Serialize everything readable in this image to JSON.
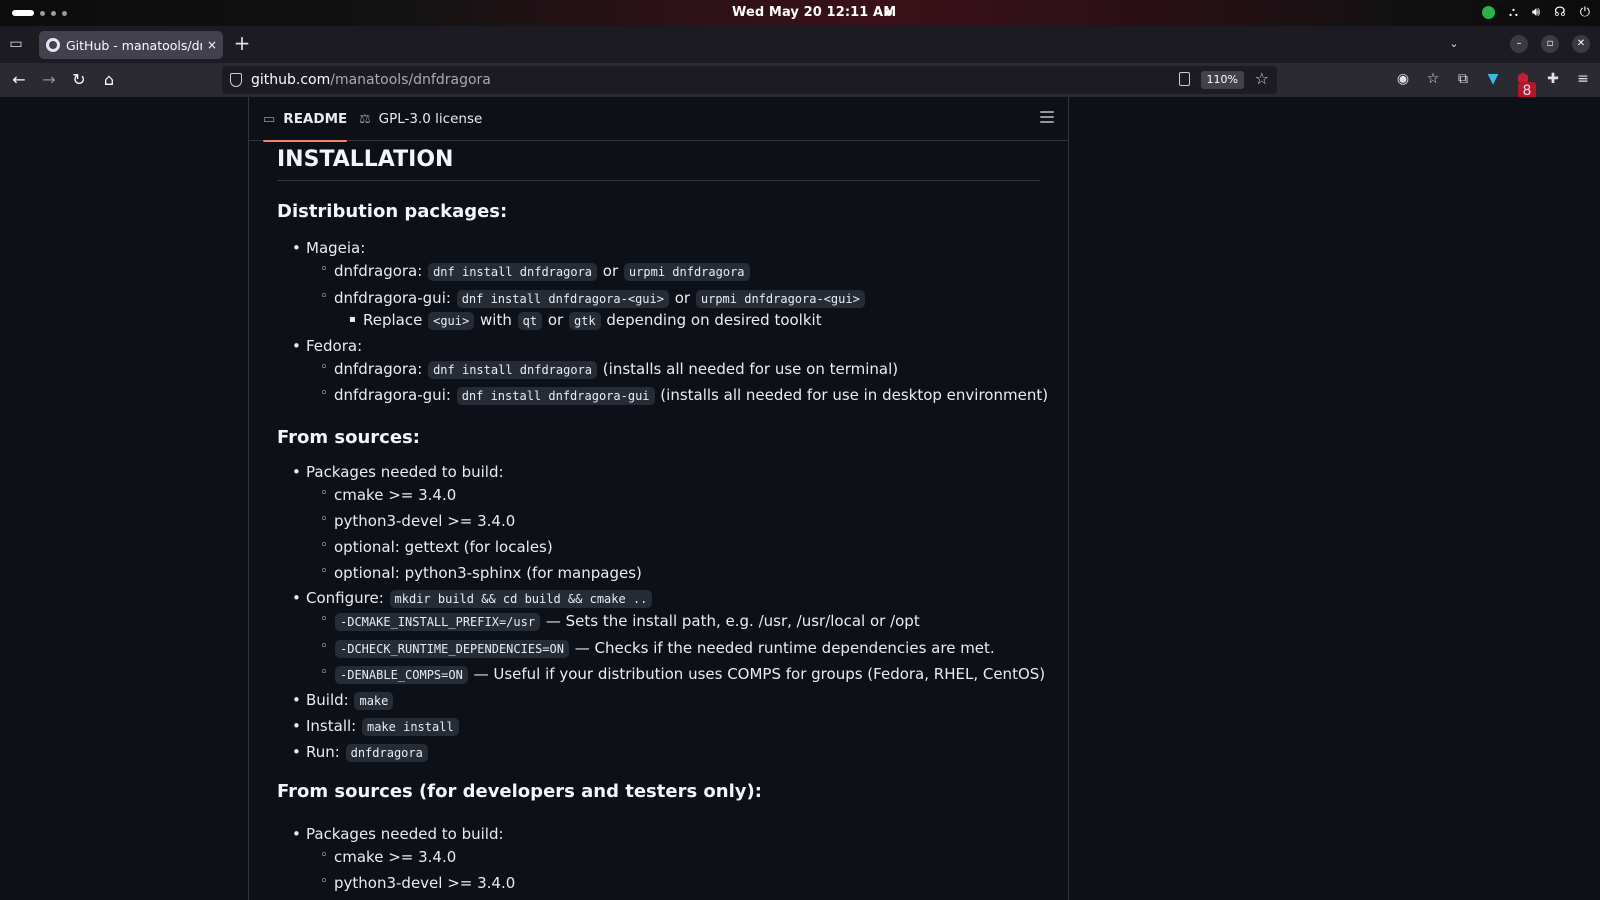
{
  "system": {
    "clock": "Wed May 20  12:11 AM",
    "tray_icons": [
      "chat-icon",
      "network-icon",
      "volume-icon",
      "headphones-icon",
      "power-icon"
    ]
  },
  "browser": {
    "tab": {
      "title": "GitHub - manatools/dnfdragora",
      "close": "×"
    },
    "newtab": "+",
    "url": {
      "host": "github.com",
      "path": "/manatools/dnfdragora"
    },
    "zoom": "110%",
    "extension_badge": "8",
    "window_controls": {
      "minimize": "–",
      "maximize": "▫",
      "close": "✕"
    }
  },
  "readme": {
    "tabs": [
      {
        "label": "README",
        "icon": "book-icon"
      },
      {
        "label": "GPL-3.0 license",
        "icon": "scale-icon"
      }
    ],
    "h1": "INSTALLATION",
    "sec1": {
      "title": "Distribution packages:",
      "mageia": "Mageia:",
      "m_a": {
        "pre": "dnfdragora: ",
        "c1": "dnf install dnfdragora",
        "mid": " or ",
        "c2": "urpmi dnfdragora"
      },
      "m_b": {
        "pre": "dnfdragora-gui: ",
        "c1": "dnf install dnfdragora-<gui>",
        "mid": " or ",
        "c2": "urpmi dnfdragora-<gui>"
      },
      "m_c": {
        "pre": "Replace ",
        "c1": "<gui>",
        "m1": " with ",
        "c2": "qt",
        "m2": " or ",
        "c3": "gtk",
        "post": " depending on desired toolkit"
      },
      "fedora": "Fedora:",
      "f_a": {
        "pre": "dnfdragora: ",
        "c1": "dnf install dnfdragora",
        "post": " (installs all needed for use on terminal)"
      },
      "f_b": {
        "pre": "dnfdragora-gui: ",
        "c1": "dnf install dnfdragora-gui",
        "post": " (installs all needed for use in desktop environment)"
      }
    },
    "sec2": {
      "title": "From sources:",
      "packages": "Packages needed to build:",
      "p1": "cmake >= 3.4.0",
      "p2": "python3-devel >= 3.4.0",
      "p3": "optional: gettext (for locales)",
      "p4": "optional: python3-sphinx (for manpages)",
      "configure": {
        "pre": "Configure: ",
        "c1": "mkdir build && cd build && cmake .."
      },
      "opt1": {
        "c1": "-DCMAKE_INSTALL_PREFIX=/usr",
        "post": " — Sets the install path, e.g. /usr, /usr/local or /opt"
      },
      "opt2": {
        "c1": "-DCHECK_RUNTIME_DEPENDENCIES=ON",
        "post": " — Checks if the needed runtime dependencies are met."
      },
      "opt3": {
        "c1": "-DENABLE_COMPS=ON",
        "post": " — Useful if your distribution uses COMPS for groups (Fedora, RHEL, CentOS)"
      },
      "build": {
        "pre": "Build: ",
        "c1": "make"
      },
      "install": {
        "pre": "Install: ",
        "c1": "make install"
      },
      "run": {
        "pre": "Run: ",
        "c1": "dnfdragora"
      }
    },
    "sec3": {
      "title": "From sources (for developers and testers only):",
      "packages": "Packages needed to build:",
      "p1": "cmake >= 3.4.0",
      "p2": "python3-devel >= 3.4.0"
    }
  }
}
